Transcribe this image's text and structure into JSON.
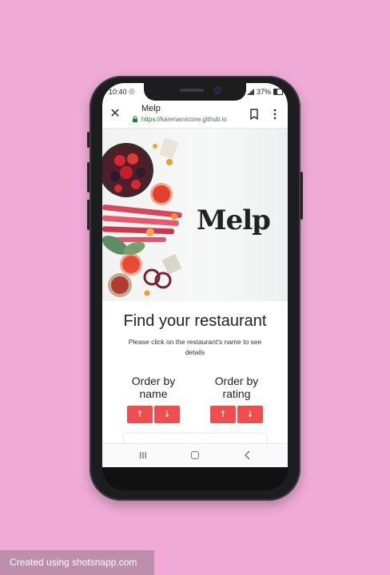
{
  "status_bar": {
    "time": "10:40",
    "battery": "37%"
  },
  "browser": {
    "title": "Melp",
    "url_scheme": "https://",
    "url_host": "karenamicone.github.io"
  },
  "hero": {
    "logo": "Melp"
  },
  "main": {
    "title": "Find your restaurant",
    "subtitle": "Please click on the restaurant's name to see details",
    "order_by_name": {
      "label": "Order by name",
      "up": "↑",
      "down": "↓"
    },
    "order_by_rating": {
      "label": "Order by rating",
      "up": "↑",
      "down": "↓"
    }
  },
  "icons": {
    "close": "close-icon",
    "lock": "lock-icon",
    "bookmark": "bookmark-icon",
    "menu": "more-vert-icon",
    "recent": "recent-apps-icon",
    "home": "home-icon",
    "back": "back-icon"
  },
  "colors": {
    "background": "#efaad6",
    "accent": "#ef4e50",
    "url_green": "#188038"
  },
  "watermark": "Created using shotsnapp.com"
}
